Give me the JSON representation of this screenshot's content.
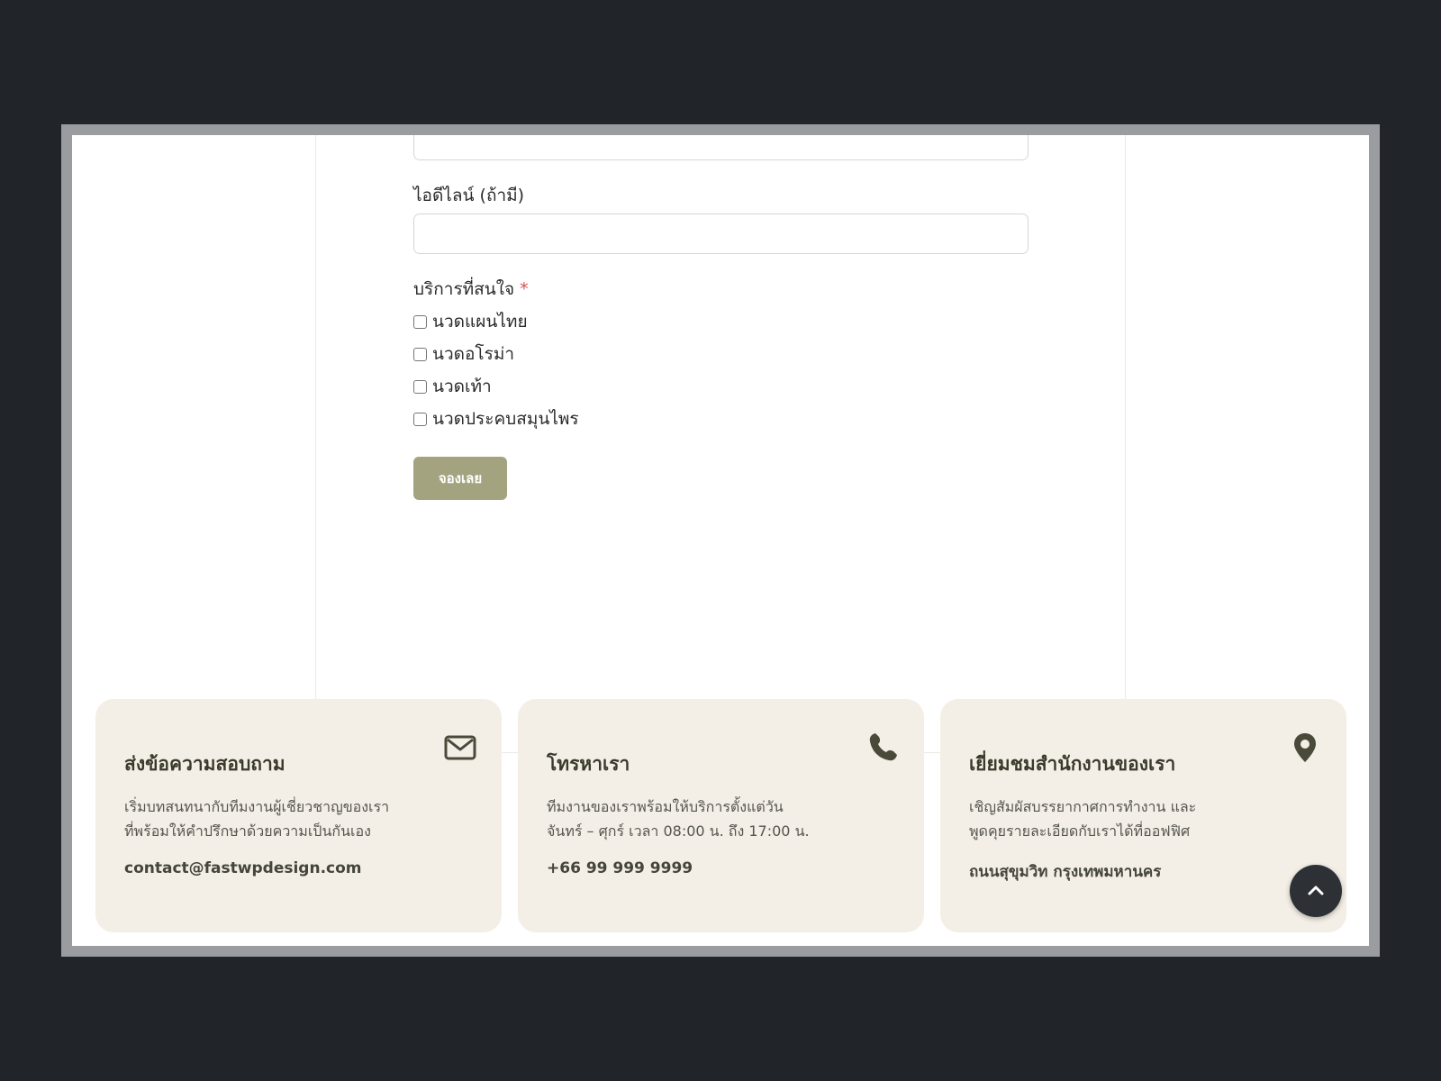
{
  "form": {
    "line_id_label": "ไอดีไลน์ (ถ้ามี)",
    "line_id_value": "",
    "services_label": "บริการที่สนใจ",
    "services_required_mark": "*",
    "services": [
      {
        "label": "นวดแผนไทย",
        "checked": false
      },
      {
        "label": "นวดอโรม่า",
        "checked": false
      },
      {
        "label": "นวดเท้า",
        "checked": false
      },
      {
        "label": "นวดประคบสมุนไพร",
        "checked": false
      }
    ],
    "submit_label": "จองเลย"
  },
  "info_cards": [
    {
      "title": "ส่งข้อความสอบถาม",
      "desc_line1": "เริ่มบทสนทนากับทีมงานผู้เชี่ยวชาญของเรา",
      "desc_line2": "ที่พร้อมให้คำปรึกษาด้วยความเป็นกันเอง",
      "contact": "contact@fastwpdesign.com",
      "icon": "envelope-icon"
    },
    {
      "title": "โทรหาเรา",
      "desc_line1": "ทีมงานของเราพร้อมให้บริการตั้งแต่วัน",
      "desc_line2": "จันทร์ – ศุกร์ เวลา 08:00 น. ถึง 17:00 น.",
      "contact": "+66 99 999 9999",
      "icon": "phone-icon"
    },
    {
      "title": "เยี่ยมชมสำนักงานของเรา",
      "desc_line1": "เชิญสัมผัสบรรยากาศการทำงาน และ",
      "desc_line2": "พูดคุยรายละเอียดกับเราได้ที่ออฟฟิศ",
      "contact": "ถนนสุขุมวิท กรุงเทพมหานคร",
      "icon": "map-pin-icon"
    }
  ],
  "colors": {
    "accent_button": "#a3a47f",
    "card_bg": "#f4efe6",
    "icon_color": "#4a4a3a",
    "required": "#d9534f",
    "backdrop": "#212529"
  },
  "scroll_top_icon": "chevron-up-icon"
}
